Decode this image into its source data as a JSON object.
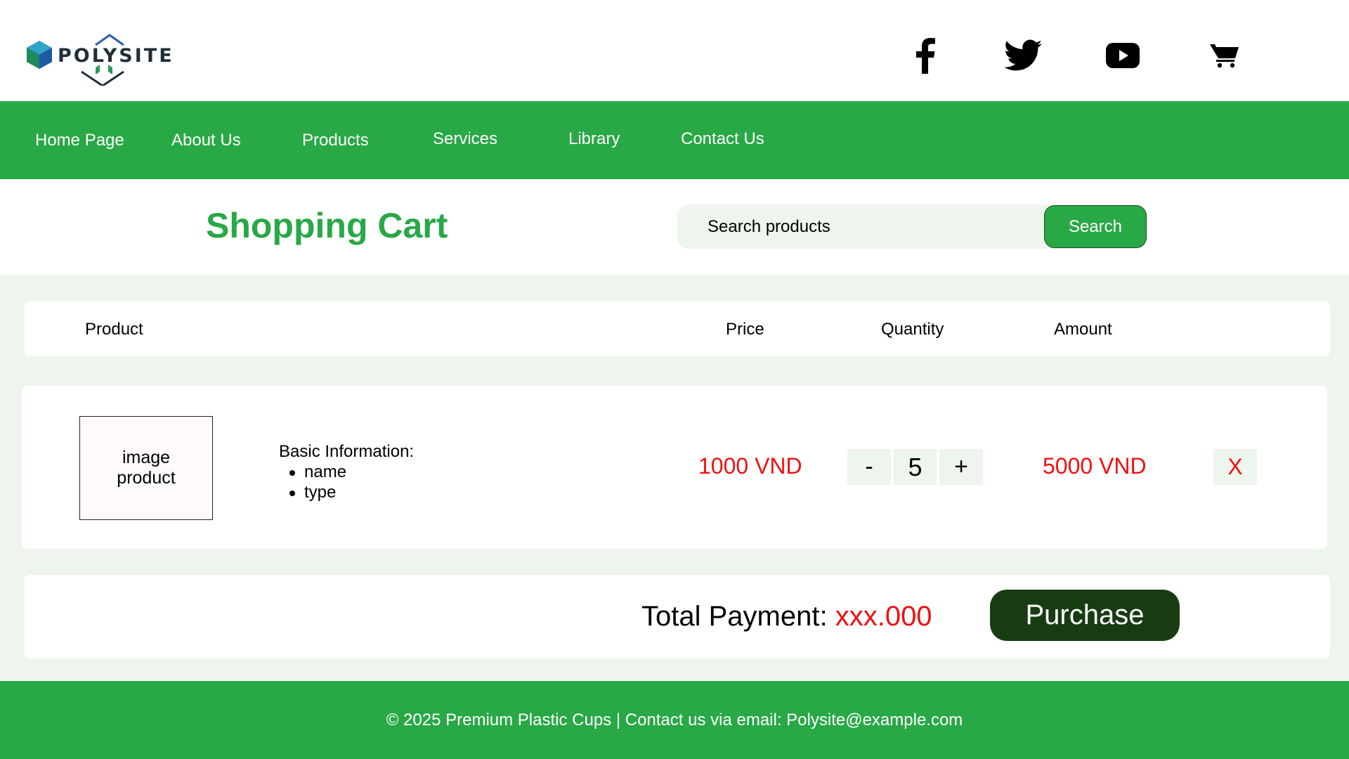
{
  "header": {
    "logo_text": "POLYSITE",
    "social": [
      {
        "icon": "facebook-icon"
      },
      {
        "icon": "twitter-icon"
      },
      {
        "icon": "youtube-icon"
      },
      {
        "icon": "cart-icon"
      }
    ]
  },
  "nav": {
    "items": [
      "Home Page",
      "About Us",
      "Products",
      "Services",
      "Library",
      "Contact Us"
    ]
  },
  "page": {
    "title": "Shopping Cart"
  },
  "search": {
    "placeholder": "Search products",
    "button_label": "Search"
  },
  "table": {
    "headers": [
      "Product",
      "Price",
      "Quantity",
      "Amount"
    ]
  },
  "cart_item": {
    "image_label_line1": "image",
    "image_label_line2": "product",
    "info_title": "Basic Information:",
    "info_fields": [
      "name",
      "type"
    ],
    "price": "1000 VND",
    "decrement_label": "-",
    "quantity": "5",
    "increment_label": "+",
    "amount": "5000 VND",
    "remove_label": "X"
  },
  "summary": {
    "total_label": "Total Payment:",
    "total_value": "xxx.000",
    "purchase_label": "Purchase"
  },
  "footer": {
    "text": "© 2025 Premium Plastic Cups | Contact us via email: Polysite@example.com"
  },
  "colors": {
    "brand_green": "#29a846",
    "light_green_bg": "#eef5ec",
    "dark_green": "#183c12",
    "price_red": "#ee1111"
  }
}
